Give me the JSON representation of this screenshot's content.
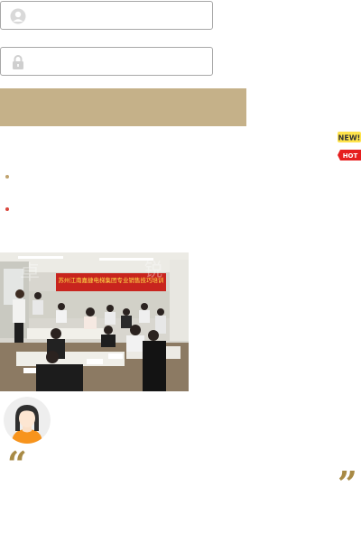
{
  "login": {
    "username_placeholder": "",
    "password_placeholder": "",
    "submit_label": ""
  },
  "badges": {
    "new": "NEW!",
    "hot": "HOT"
  },
  "banner": {
    "text": "苏州江南嘉捷电梯集团专业销售技巧培训"
  },
  "quote": {
    "open": "“",
    "close": "”"
  },
  "icons": {
    "user": "user-icon",
    "lock": "lock-icon",
    "avatar": "avatar-icon"
  },
  "colors": {
    "accent": "#c5b189",
    "quote": "#a88a45",
    "bullet_gold": "#bfa26d",
    "bullet_red": "#d9473d",
    "field_border": "#a7a7a7"
  }
}
